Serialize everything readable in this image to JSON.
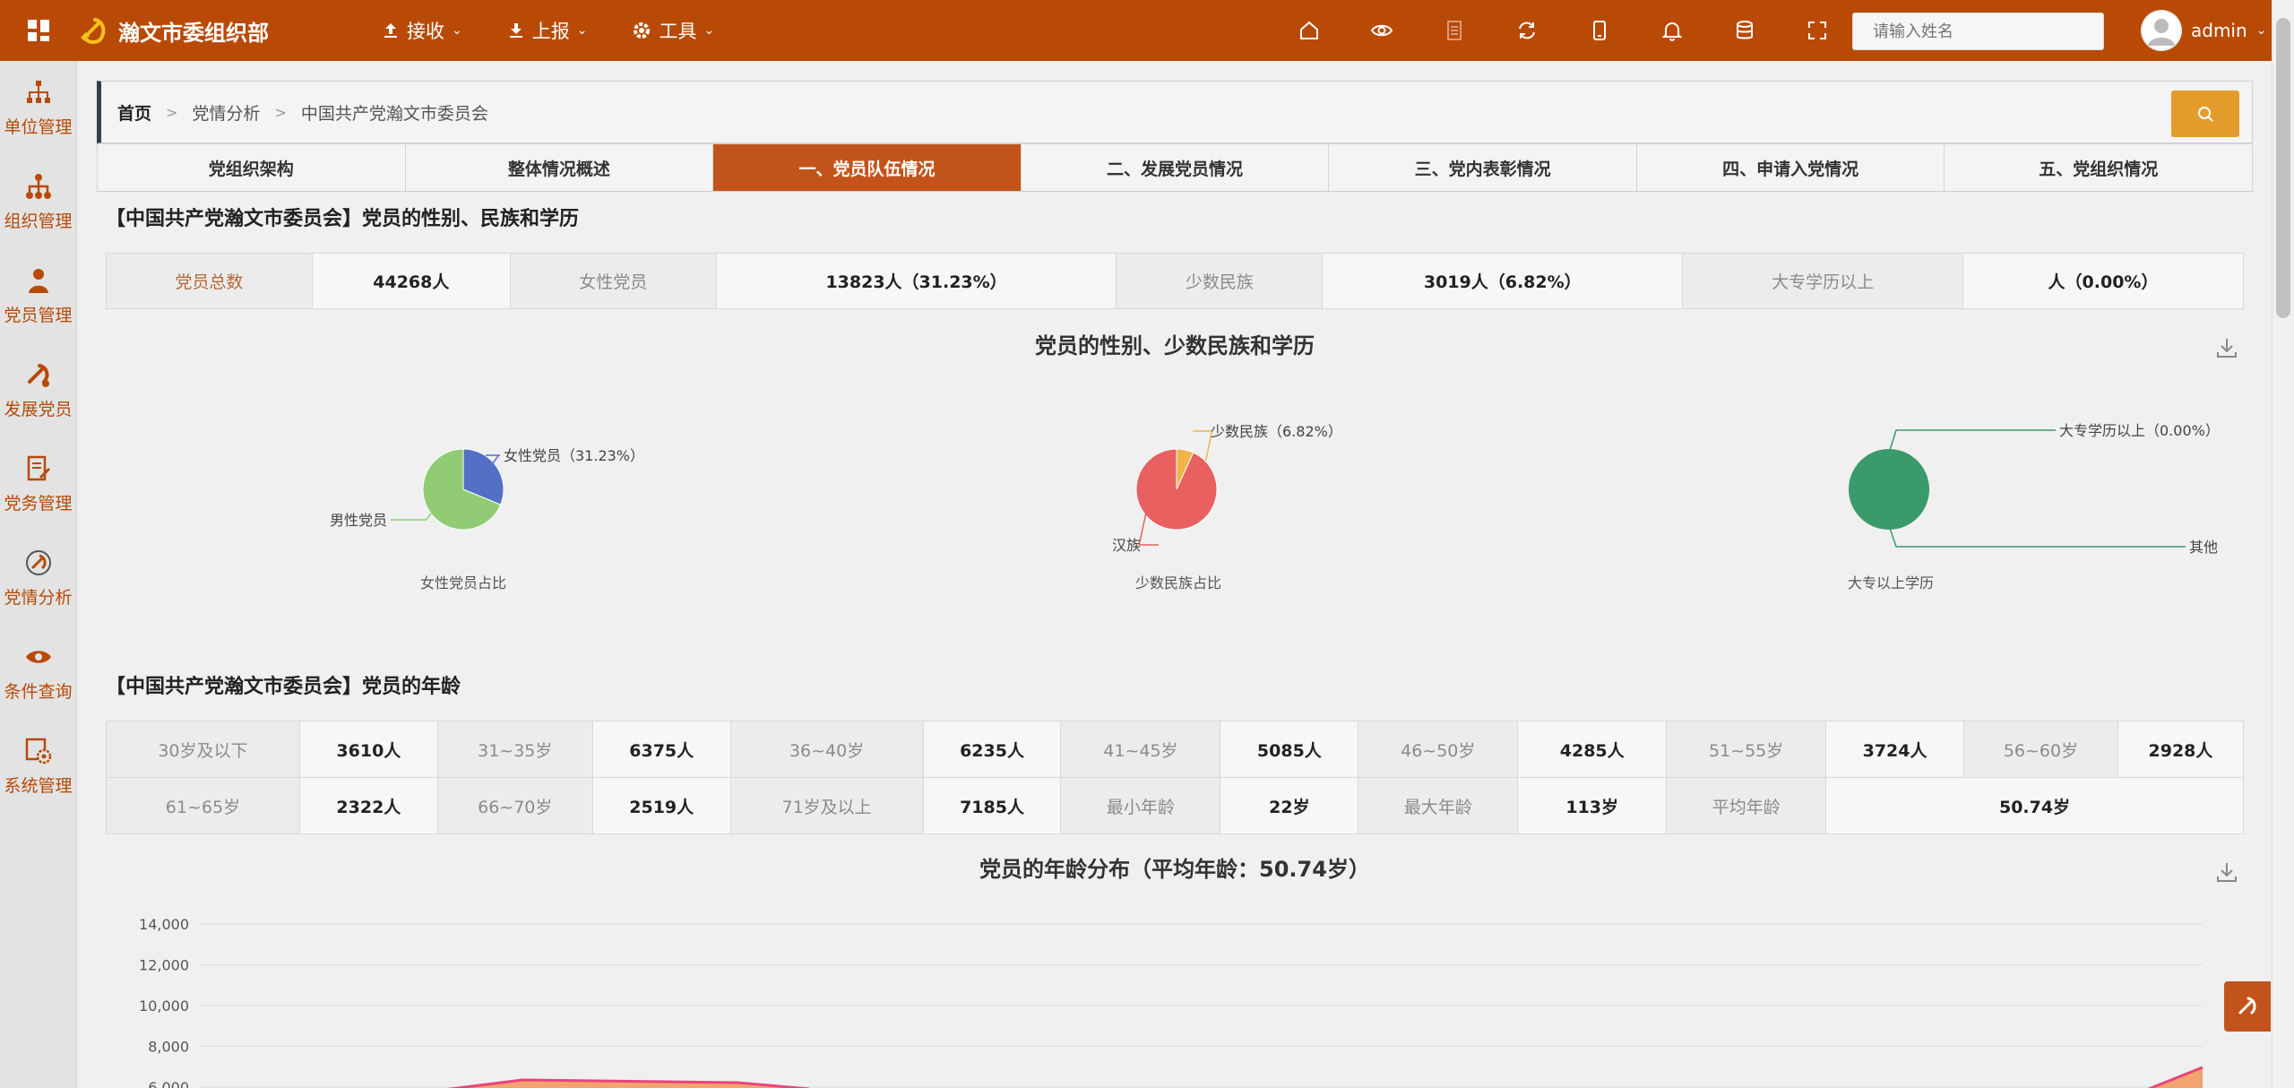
{
  "header": {
    "brand": "瀚文市委组织部",
    "menus": [
      {
        "label": "接收"
      },
      {
        "label": "上报"
      },
      {
        "label": "工具"
      }
    ],
    "search_placeholder": "请输入姓名",
    "username": "admin",
    "icons": [
      "home-icon",
      "eye-icon",
      "document-icon",
      "refresh-icon",
      "tablet-icon",
      "bell-icon",
      "database-icon",
      "fullscreen-icon"
    ]
  },
  "sidebar": {
    "items": [
      {
        "label": "单位管理"
      },
      {
        "label": "组织管理"
      },
      {
        "label": "党员管理"
      },
      {
        "label": "发展党员"
      },
      {
        "label": "党务管理"
      },
      {
        "label": "党情分析"
      },
      {
        "label": "条件查询"
      },
      {
        "label": "系统管理"
      }
    ]
  },
  "breadcrumb": {
    "home": "首页",
    "items": [
      "党情分析",
      "中国共产党瀚文市委员会"
    ]
  },
  "tabs": [
    {
      "label": "党组织架构"
    },
    {
      "label": "整体情况概述"
    },
    {
      "label": "一、党员队伍情况",
      "active": true
    },
    {
      "label": "二、发展党员情况"
    },
    {
      "label": "三、党内表彰情况"
    },
    {
      "label": "四、申请入党情况"
    },
    {
      "label": "五、党组织情况"
    }
  ],
  "section1": {
    "title": "【中国共产党瀚文市委员会】党员的性别、民族和学历",
    "stats": [
      {
        "label": "党员总数",
        "value": "44268人"
      },
      {
        "label": "女性党员",
        "value": "13823人（31.23%）"
      },
      {
        "label": "少数民族",
        "value": "3019人（6.82%）"
      },
      {
        "label": "大专学历以上",
        "value": "人（0.00%）"
      }
    ],
    "chart_title": "党员的性别、少数民族和学历"
  },
  "chart_data": [
    {
      "type": "pie",
      "title": "女性党员占比",
      "slices": [
        {
          "name": "女性党员",
          "label": "女性党员（31.23%）",
          "value": 31.23,
          "color": "#5470c6"
        },
        {
          "name": "男性党员",
          "label": "男性党员",
          "value": 68.77,
          "color": "#91cc75"
        }
      ]
    },
    {
      "type": "pie",
      "title": "少数民族占比",
      "slices": [
        {
          "name": "少数民族",
          "label": "少数民族（6.82%）",
          "value": 6.82,
          "color": "#f0b44a"
        },
        {
          "name": "汉族",
          "label": "汉族",
          "value": 93.18,
          "color": "#e86060"
        }
      ]
    },
    {
      "type": "pie",
      "title": "大专以上学历",
      "slices": [
        {
          "name": "大专学历以上",
          "label": "大专学历以上（0.00%）",
          "value": 0,
          "color": "#3ba272"
        },
        {
          "name": "其他",
          "label": "其他",
          "value": 100,
          "color": "#3a9a6a"
        }
      ]
    },
    {
      "type": "area",
      "title": "党员的年龄分布（平均年龄：50.74岁）",
      "yticks": [
        "14,000",
        "12,000",
        "10,000",
        "8,000",
        "6,000"
      ],
      "ylim": [
        0,
        14000
      ]
    }
  ],
  "section2": {
    "title": "【中国共产党瀚文市委员会】党员的年龄",
    "row1": [
      {
        "label": "30岁及以下",
        "value": "3610人"
      },
      {
        "label": "31~35岁",
        "value": "6375人"
      },
      {
        "label": "36~40岁",
        "value": "6235人"
      },
      {
        "label": "41~45岁",
        "value": "5085人"
      },
      {
        "label": "46~50岁",
        "value": "4285人"
      },
      {
        "label": "51~55岁",
        "value": "3724人"
      },
      {
        "label": "56~60岁",
        "value": "2928人"
      }
    ],
    "row2": [
      {
        "label": "61~65岁",
        "value": "2322人"
      },
      {
        "label": "66~70岁",
        "value": "2519人"
      },
      {
        "label": "71岁及以上",
        "value": "7185人"
      },
      {
        "label": "最小年龄",
        "value": "22岁"
      },
      {
        "label": "最大年龄",
        "value": "113岁"
      },
      {
        "label": "平均年龄",
        "value": "50.74岁"
      }
    ]
  }
}
